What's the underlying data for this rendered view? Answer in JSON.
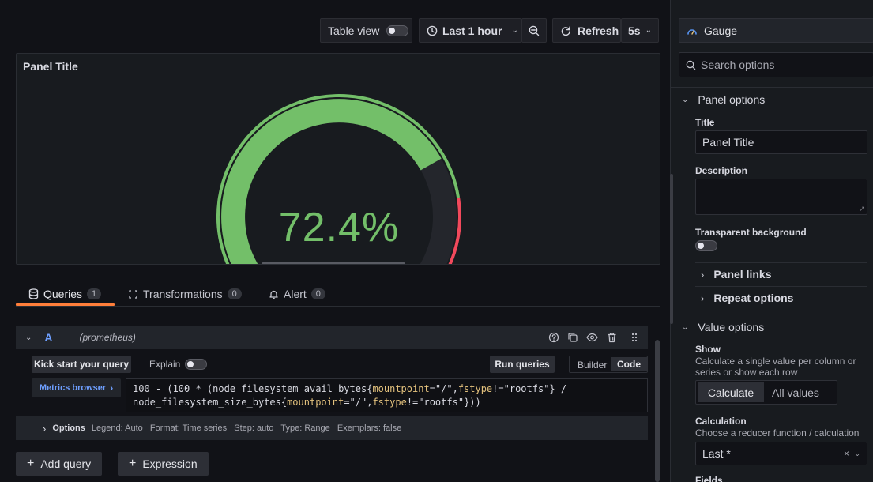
{
  "toolbar": {
    "table_view_label": "Table view",
    "time_range_label": "Last 1 hour",
    "refresh_label": "Refresh",
    "refresh_interval": "5s"
  },
  "panel": {
    "title": "Panel Title",
    "gauge_value": 72.4,
    "gauge_display": "72.4%",
    "gauge_color": "#73bf69",
    "threshold_color": "#f2495c"
  },
  "tabs": [
    {
      "label": "Queries",
      "count": "1"
    },
    {
      "label": "Transformations",
      "count": "0"
    },
    {
      "label": "Alert",
      "count": "0"
    }
  ],
  "query": {
    "ref_id": "A",
    "datasource": "(prometheus)",
    "kick_start_label": "Kick start your query",
    "explain_label": "Explain",
    "run_queries_label": "Run queries",
    "mode_builder": "Builder",
    "mode_code": "Code",
    "metrics_browser_label": "Metrics browser",
    "code_line1_prefix": "100 - (100 * (node_filesystem_avail_bytes{",
    "code_line1_suffix": "} /",
    "code_line2_prefix": "node_filesystem_size_bytes{",
    "code_line2_suffix": "}))",
    "label_mountpoint": "mountpoint",
    "label_fstype": "fstype",
    "value_mountpoint": "=\"/\",",
    "value_fstype": "!=\"rootfs\"",
    "options_label": "Options",
    "options_summary": "Legend: Auto   Format: Time series   Step: auto   Type: Range   Exemplars: false"
  },
  "actions": {
    "add_query_label": "Add query",
    "expression_label": "Expression"
  },
  "sidebar": {
    "visualization": "Gauge",
    "search_placeholder": "Search options",
    "panel_options_label": "Panel options",
    "title_label": "Title",
    "title_value": "Panel Title",
    "description_label": "Description",
    "transparent_label": "Transparent background",
    "panel_links_label": "Panel links",
    "repeat_options_label": "Repeat options",
    "value_options_label": "Value options",
    "show_label": "Show",
    "show_desc": "Calculate a single value per column or series or show each row",
    "calculate_label": "Calculate",
    "all_values_label": "All values",
    "calculation_label": "Calculation",
    "calculation_desc": "Choose a reducer function / calculation",
    "calculation_value": "Last *",
    "fields_label": "Fields"
  }
}
